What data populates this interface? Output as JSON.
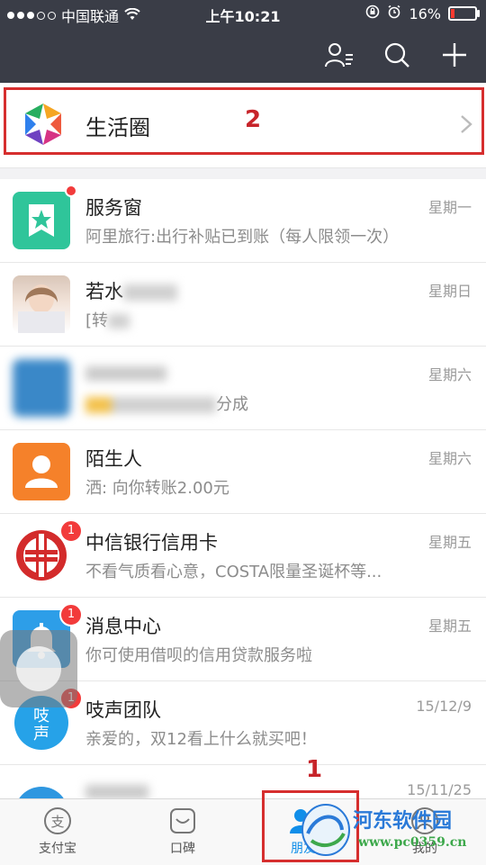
{
  "status_bar": {
    "carrier": "中国联通",
    "time": "上午10:21",
    "battery": "16%",
    "battery_level": 0.16
  },
  "header": {
    "icons": [
      "contacts-icon",
      "search-icon",
      "add-icon"
    ]
  },
  "life_circle": {
    "label": "生活圈",
    "annotation": "2"
  },
  "conversations": [
    {
      "name": "服务窗",
      "preview": "阿里旅行:出行补贴已到账（每人限领一次）",
      "time": "星期一",
      "badge": "",
      "icon": "service-window-icon"
    },
    {
      "name": "若水",
      "preview": "[转",
      "time": "星期日",
      "badge": "",
      "icon": "user-avatar"
    },
    {
      "name": "",
      "preview": "分成",
      "time": "星期六",
      "badge": "",
      "icon": "blurred-avatar"
    },
    {
      "name": "陌生人",
      "preview": "洒: 向你转账2.00元",
      "time": "星期六",
      "badge": "",
      "icon": "stranger-icon"
    },
    {
      "name": "中信银行信用卡",
      "preview": "不看气质看心意，COSTA限量圣诞杯等...",
      "time": "星期五",
      "badge": "1",
      "icon": "citic-logo"
    },
    {
      "name": "消息中心",
      "preview": "你可使用借呗的信用贷款服务啦",
      "time": "星期五",
      "badge": "1",
      "icon": "bell-icon"
    },
    {
      "name": "吱声团队",
      "preview": "亲爱的，双12看上什么就买吧！",
      "time": "15/12/9",
      "badge": "1",
      "icon": "zhisheng-icon"
    },
    {
      "name": "",
      "preview": "",
      "time": "15/11/25",
      "badge": "",
      "icon": "blurred-avatar"
    }
  ],
  "tabbar": {
    "tabs": [
      {
        "label": "支付宝",
        "icon": "alipay-icon"
      },
      {
        "label": "口碑",
        "icon": "koubei-icon"
      },
      {
        "label": "朋友",
        "icon": "friends-icon"
      },
      {
        "label": "我的",
        "icon": "profile-icon"
      }
    ],
    "annotation": "1"
  },
  "watermark": {
    "title": "河东软件园",
    "url": "www.pc0359.cn"
  },
  "colors": {
    "header_bg": "#3a3d47",
    "annotation_red": "#d62e2e",
    "active_tab": "#108ee9"
  }
}
